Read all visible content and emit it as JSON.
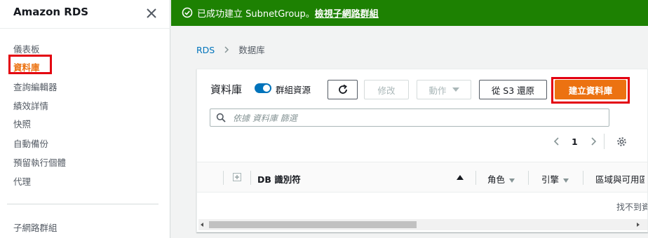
{
  "sidebar": {
    "title": "Amazon RDS",
    "items": [
      {
        "label": "儀表板"
      },
      {
        "label": "資料庫"
      },
      {
        "label": "查詢編輯器"
      },
      {
        "label": "績效詳情"
      },
      {
        "label": "快照"
      },
      {
        "label": "自動備份"
      },
      {
        "label": "預留執行個體"
      },
      {
        "label": "代理"
      }
    ],
    "bottom_items": [
      {
        "label": "子網路群組"
      }
    ],
    "active_item": "資料庫"
  },
  "flash": {
    "message": "已成功建立 SubnetGroup。",
    "link": "檢視子網路群組",
    "icon": "check-circle-icon",
    "color": "#1d8102"
  },
  "breadcrumb": {
    "root": "RDS",
    "current": "数据库"
  },
  "databases": {
    "title": "資料庫",
    "toggle_label": "群組資源",
    "toggle_on": true,
    "buttons": {
      "refresh_icon": "refresh-icon",
      "modify": "修改",
      "actions": "動作",
      "restore_s3": "從 S3 還原",
      "create": "建立資料庫"
    },
    "search_placeholder": "依據 資料庫 篩選",
    "pager": {
      "page": "1"
    },
    "columns": {
      "db_id": "DB 識別符",
      "role": "角色",
      "engine": "引擎",
      "region": "區域與可用區"
    },
    "empty_text": "找不到資料庫"
  },
  "colors": {
    "accent": "#ec7211",
    "link": "#0073bb",
    "highlight": "#e3000f"
  }
}
